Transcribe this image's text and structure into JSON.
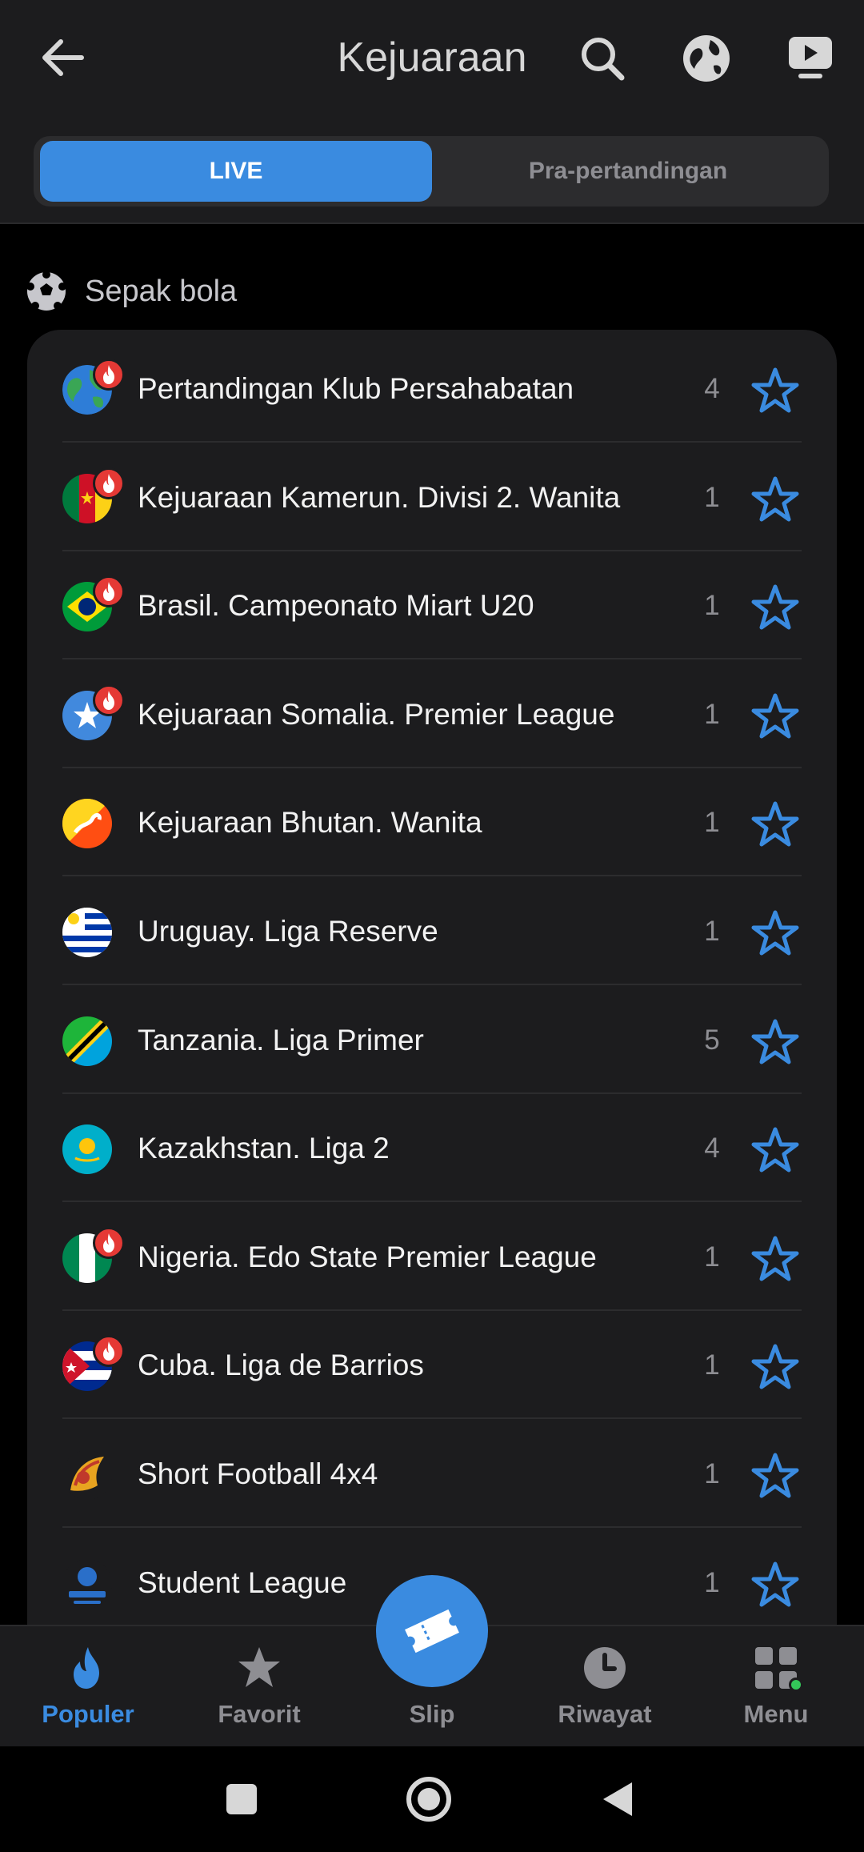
{
  "header": {
    "title": "Kejuaraan",
    "icons": [
      "back-arrow-icon",
      "search-icon",
      "globe-icon",
      "live-tv-icon"
    ]
  },
  "tabs": {
    "live": "LIVE",
    "pre": "Pra-pertandingan"
  },
  "section": {
    "label": "Sepak bola",
    "icon": "soccer-ball-icon"
  },
  "leagues": [
    {
      "name": "Pertandingan Klub Persahabatan",
      "count": "4",
      "flag": "world",
      "hot": true
    },
    {
      "name": "Kejuaraan Kamerun. Divisi 2. Wanita",
      "count": "1",
      "flag": "cameroon",
      "hot": true
    },
    {
      "name": "Brasil. Campeonato Miart U20",
      "count": "1",
      "flag": "brazil",
      "hot": true
    },
    {
      "name": "Kejuaraan Somalia. Premier League",
      "count": "1",
      "flag": "somalia",
      "hot": true
    },
    {
      "name": "Kejuaraan Bhutan. Wanita",
      "count": "1",
      "flag": "bhutan",
      "hot": false
    },
    {
      "name": "Uruguay. Liga Reserve",
      "count": "1",
      "flag": "uruguay",
      "hot": false
    },
    {
      "name": "Tanzania. Liga Primer",
      "count": "5",
      "flag": "tanzania",
      "hot": false
    },
    {
      "name": "Kazakhstan. Liga 2",
      "count": "4",
      "flag": "kazakhstan",
      "hot": false
    },
    {
      "name": "Nigeria. Edo State Premier League",
      "count": "1",
      "flag": "nigeria",
      "hot": true
    },
    {
      "name": "Cuba. Liga de Barrios",
      "count": "1",
      "flag": "cuba",
      "hot": true
    },
    {
      "name": "Short Football 4x4",
      "count": "1",
      "flag": "short-football-logo",
      "hot": false
    },
    {
      "name": "Student League",
      "count": "1",
      "flag": "student-league-logo",
      "hot": false
    }
  ],
  "bottom_nav": {
    "populer": "Populer",
    "favorit": "Favorit",
    "slip": "Slip",
    "riwayat": "Riwayat",
    "menu": "Menu"
  },
  "colors": {
    "accent": "#3a8be0",
    "background": "#000000",
    "card": "#1c1c1e",
    "hot_badge": "#e53935"
  }
}
